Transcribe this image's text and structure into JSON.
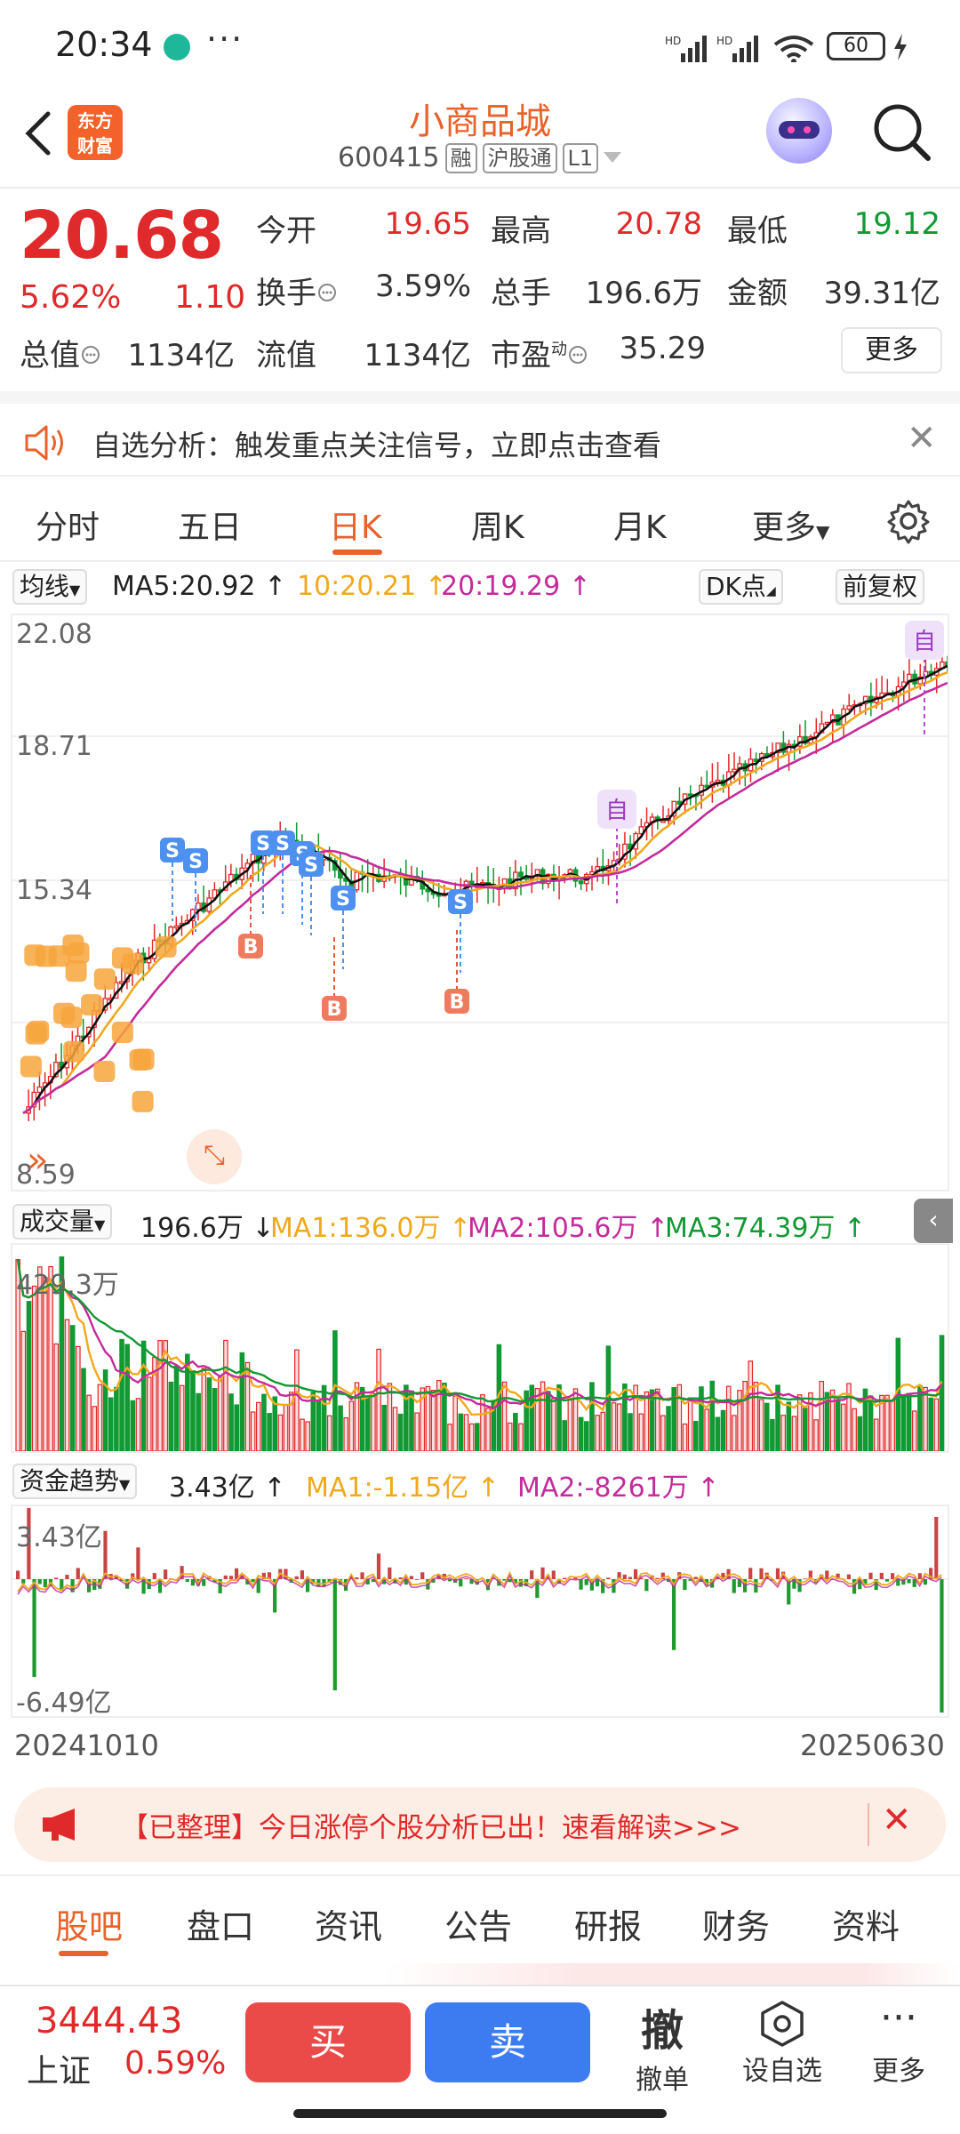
{
  "status_bar": {
    "time": "20:34",
    "dots": "···",
    "battery": "60"
  },
  "header": {
    "logo_line1": "东方",
    "logo_line2": "财富",
    "stock_name": "小商品城",
    "stock_code": "600415",
    "tags": [
      "融",
      "沪股通",
      "L1"
    ]
  },
  "quote": {
    "price": "20.68",
    "pct": "5.62%",
    "change": "1.10",
    "rows": [
      [
        {
          "label": "今开",
          "value": "19.65",
          "color": "red"
        },
        {
          "label": "最高",
          "value": "20.78",
          "color": "red"
        },
        {
          "label": "最低",
          "value": "19.12",
          "color": "green"
        }
      ],
      [
        {
          "label": "换手",
          "value": "3.59%",
          "color": "dark"
        },
        {
          "label": "总手",
          "value": "196.6万",
          "color": "dark"
        },
        {
          "label": "金额",
          "value": "39.31亿",
          "color": "dark"
        }
      ],
      [
        {
          "label": "总值",
          "value": "1134亿",
          "color": "dark"
        },
        {
          "label": "流值",
          "value": "1134亿",
          "color": "dark"
        },
        {
          "label": "市盈",
          "value": "35.29",
          "color": "dark"
        }
      ]
    ],
    "pe_superscript": "动",
    "more_label": "更多"
  },
  "alert": {
    "text": "自选分析：触发重点关注信号，立即点击查看"
  },
  "tabs": [
    "分时",
    "五日",
    "日K",
    "周K",
    "月K",
    "更多"
  ],
  "active_tab": "日K",
  "ma_legend": {
    "selector": "均线",
    "ma5": "MA5:20.92",
    "ma10": "10:20.21",
    "ma20": "20:19.29",
    "dk_label": "DK点",
    "fq_label": "前复权"
  },
  "kline": {
    "axis": [
      "22.08",
      "18.71",
      "15.34",
      "8.59"
    ],
    "mark_self": "自",
    "mark_s": "S",
    "mark_b": "B"
  },
  "volume": {
    "selector": "成交量",
    "value": "196.6万",
    "ma1": "MA1:136.0万",
    "ma2": "MA2:105.6万",
    "ma3": "MA3:74.39万",
    "axis_top": "429.3万"
  },
  "fund": {
    "selector": "资金趋势",
    "value": "3.43亿",
    "ma1": "MA1:-1.15亿",
    "ma2": "MA2:-8261万",
    "axis_top": "3.43亿",
    "axis_bottom": "-6.49亿"
  },
  "dates": {
    "start": "20241010",
    "end": "20250630"
  },
  "promo": {
    "text": "【已整理】今日涨停个股分析已出！速看解读>>>"
  },
  "bottom_tabs": [
    "股吧",
    "盘口",
    "资讯",
    "公告",
    "研报",
    "财务",
    "资料"
  ],
  "action_bar": {
    "index_value": "3444.43",
    "index_name": "上证",
    "index_pct": "0.59%",
    "buy": "买",
    "sell": "卖",
    "cancel_icon": "撤",
    "cancel": "撤单",
    "watch": "设自选",
    "more": "更多"
  },
  "colors": {
    "up": "#e0292a",
    "down": "#119933",
    "accent": "#e8632b",
    "ma5": "#111111",
    "ma10": "#f0a91e",
    "ma20": "#c42b9b"
  }
}
